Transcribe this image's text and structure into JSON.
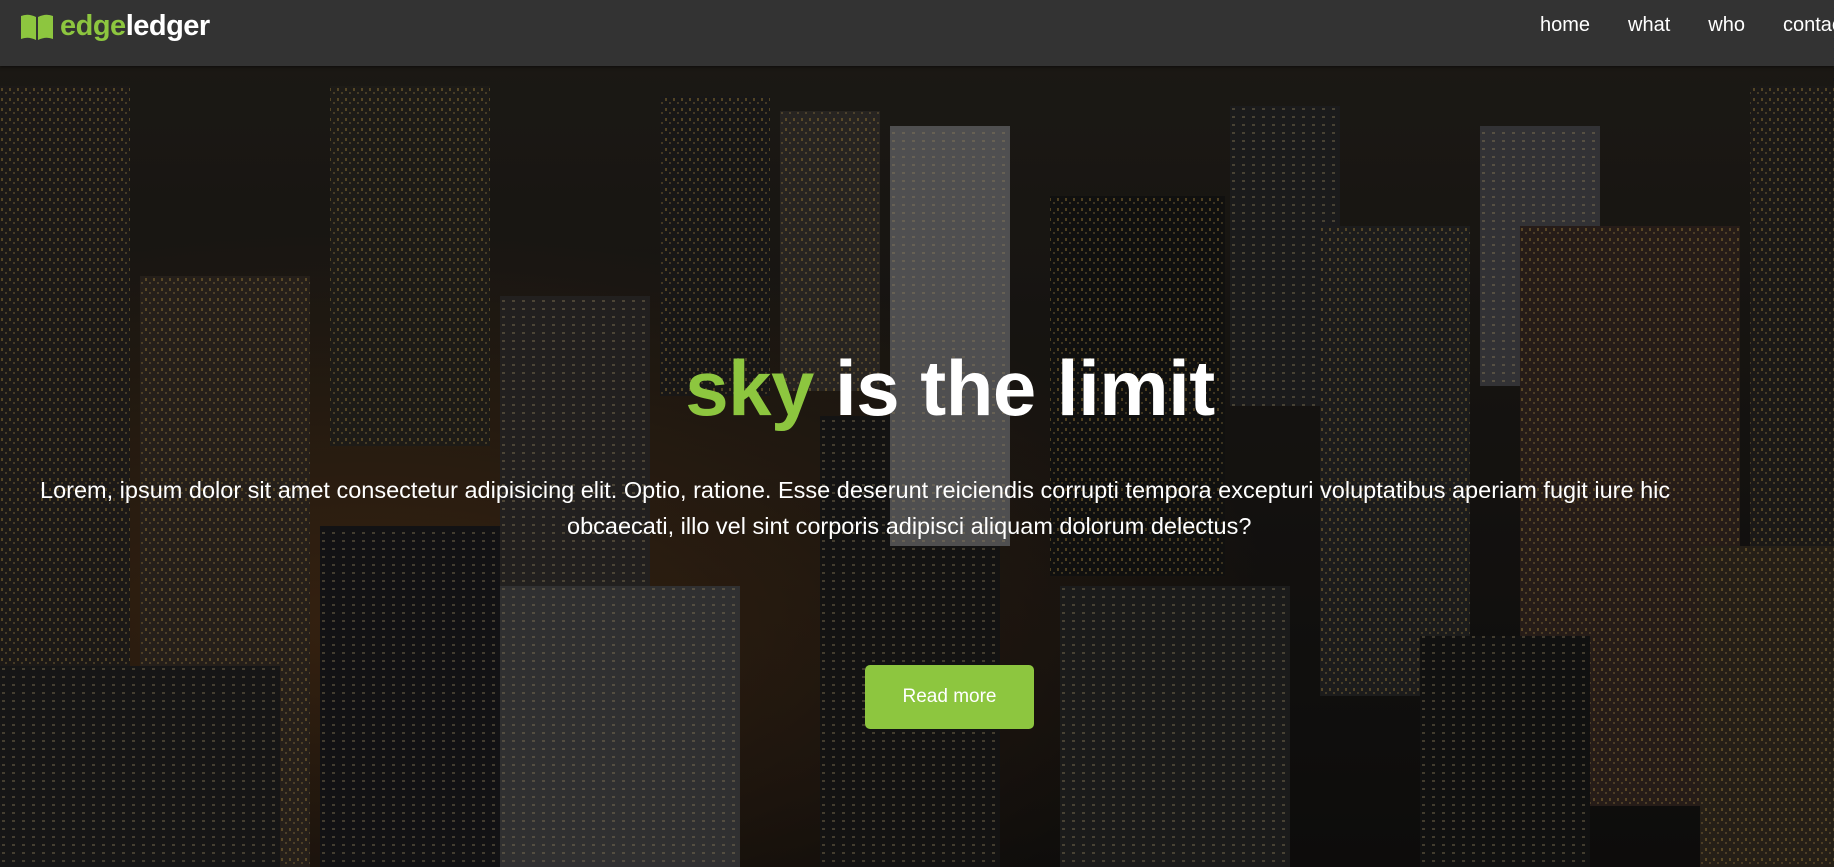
{
  "brand": {
    "name_part1": "edge",
    "name_part2": "ledger",
    "icon": "book-open-icon"
  },
  "nav": {
    "links": [
      {
        "label": "home"
      },
      {
        "label": "what"
      },
      {
        "label": "who"
      },
      {
        "label": "contact"
      }
    ]
  },
  "hero": {
    "title_accent": "sky",
    "title_rest": " is the limit",
    "text_line1": "Lorem, ipsum dolor sit amet consectetur adipisicing elit. Optio, ratione. Esse deserunt reiciendis corrupti tempora excepturi voluptatibus aperiam fugit iure hic",
    "text_line2": "obcaecati, illo vel sint corporis adipisci aliquam dolorum delectus?",
    "button_label": "Read more"
  },
  "colors": {
    "accent": "#8dc63f",
    "navbar": "#333333",
    "text": "#ffffff"
  }
}
